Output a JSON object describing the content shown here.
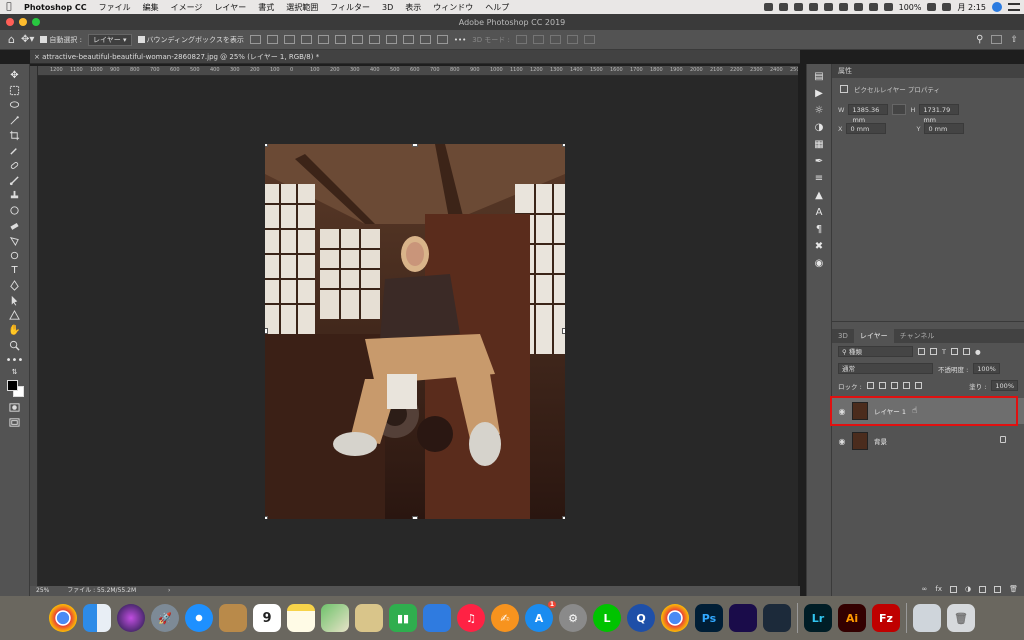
{
  "menubar": {
    "apple": "",
    "app_name": "Photoshop CC",
    "items": [
      "ファイル",
      "編集",
      "イメージ",
      "レイヤー",
      "書式",
      "選択範囲",
      "フィルター",
      "3D",
      "表示",
      "ウィンドウ",
      "ヘルプ"
    ],
    "battery": "100%",
    "clock": "月 2:15"
  },
  "window": {
    "title": "Adobe Photoshop CC 2019",
    "traffic_colors": [
      "#ff5f57",
      "#febc2e",
      "#28c840"
    ]
  },
  "options": {
    "auto_select_label": "自動選択 :",
    "auto_select_value": "レイヤー",
    "bbox_label": "バウンディングボックスを表示",
    "mode_3d": "3D モード :"
  },
  "document_tab": "attractive-beautiful-beautiful-woman-2860827.jpg @ 25% (レイヤー 1, RGB/8) *",
  "ruler_ticks": [
    "1200",
    "1100",
    "1000",
    "900",
    "800",
    "700",
    "600",
    "500",
    "400",
    "300",
    "200",
    "100",
    "0",
    "100",
    "200",
    "300",
    "400",
    "500",
    "600",
    "700",
    "800",
    "900",
    "1000",
    "1100",
    "1200",
    "1300",
    "1400",
    "1500",
    "1600",
    "1700",
    "1800",
    "1900",
    "2000",
    "2100",
    "2200",
    "2300",
    "2400",
    "2500"
  ],
  "status": {
    "zoom": "25%",
    "file_info": "ファイル : 55.2M/55.2M"
  },
  "properties": {
    "tab": "属性",
    "title": "ピクセルレイヤー プロパティ",
    "w_label": "W",
    "w_value": "1385.36 mm",
    "h_label": "H",
    "h_value": "1731.79 mm",
    "x_label": "X",
    "x_value": "0 mm",
    "y_label": "Y",
    "y_value": "0 mm"
  },
  "layers": {
    "tabs": [
      "3D",
      "レイヤー",
      "チャンネル"
    ],
    "filter_label": "種類",
    "blend_mode": "通常",
    "opacity_label": "不透明度 :",
    "opacity_value": "100%",
    "lock_label": "ロック :",
    "fill_label": "塗り :",
    "fill_value": "100%",
    "items": [
      {
        "name": "レイヤー 1",
        "selected": true
      },
      {
        "name": "背景",
        "selected": false
      }
    ],
    "footer_fx": "fx"
  },
  "dock": {
    "calendar_day": "9",
    "appstore_badge": "1",
    "photoshop_label": "Ps",
    "lightroom_label": "Lr",
    "illustrator_label": "Ai",
    "filezilla_label": "Fz"
  },
  "colors": {
    "highlight": "#e01010",
    "panel_bg": "#535353",
    "canvas_bg": "#282828"
  }
}
